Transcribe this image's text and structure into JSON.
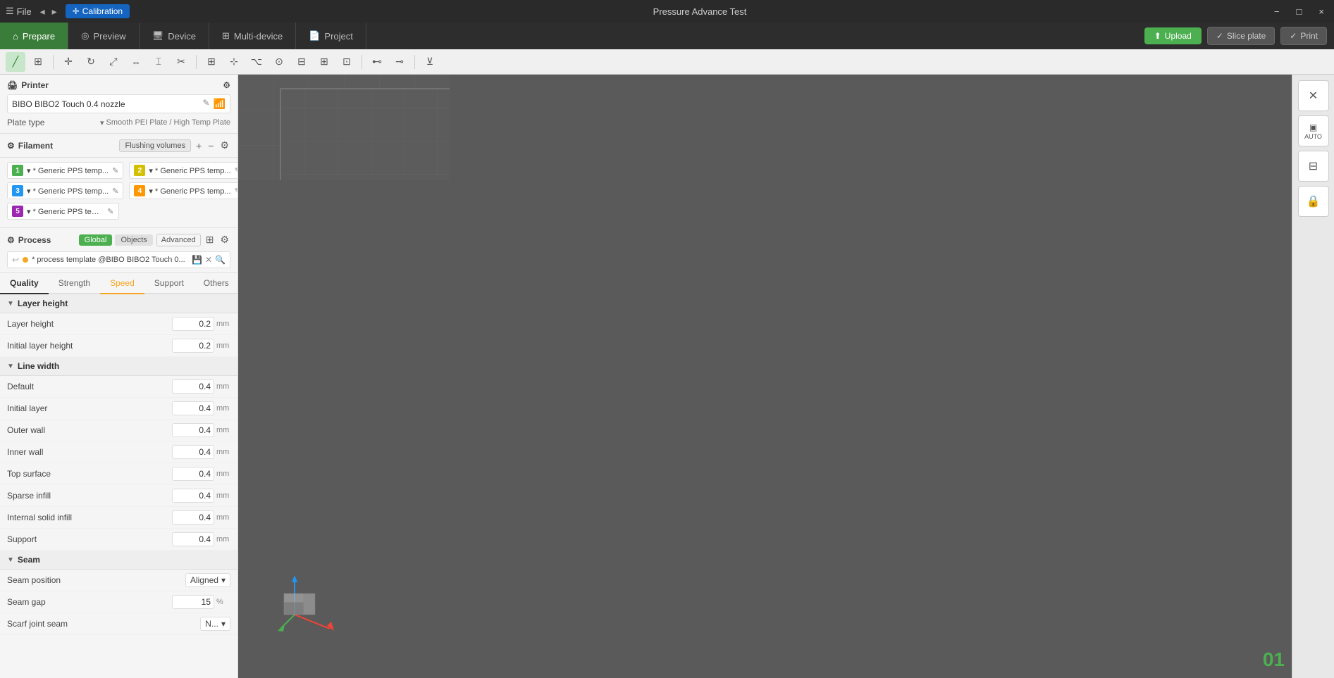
{
  "titleBar": {
    "fileLabel": "File",
    "appTitle": "Pressure Advance Test",
    "calibrationLabel": "Calibration",
    "minBtn": "−",
    "maxBtn": "□",
    "closeBtn": "×"
  },
  "navTabs": [
    {
      "id": "prepare",
      "label": "Prepare",
      "icon": "⌂",
      "active": true
    },
    {
      "id": "preview",
      "label": "Preview",
      "icon": "👁"
    },
    {
      "id": "device",
      "label": "Device",
      "icon": "🖥"
    },
    {
      "id": "multi-device",
      "label": "Multi-device",
      "icon": "⊞"
    },
    {
      "id": "project",
      "label": "Project",
      "icon": "📄"
    }
  ],
  "navButtons": {
    "upload": "Upload",
    "slicePlate": "Slice plate",
    "print": "Print"
  },
  "sidebar": {
    "printer": {
      "sectionTitle": "Printer",
      "printerName": "BIBO BIBO2 Touch 0.4 nozzle",
      "plateTypeLabel": "Plate type",
      "plateTypeValue": "Smooth PEI Plate / High Temp Plate"
    },
    "filament": {
      "sectionTitle": "Filament",
      "flushingVolumes": "Flushing volumes",
      "items": [
        {
          "num": "1",
          "name": "Generic PPS temp...",
          "color": "#4caf50"
        },
        {
          "num": "2",
          "name": "Generic PPS temp...",
          "color": "#ffeb3b"
        },
        {
          "num": "3",
          "name": "Generic PPS temp...",
          "color": "#2196f3"
        },
        {
          "num": "4",
          "name": "Generic PPS temp...",
          "color": "#ff9800"
        },
        {
          "num": "5",
          "name": "Generic PPS temp...",
          "color": "#9c27b0"
        }
      ]
    },
    "process": {
      "sectionTitle": "Process",
      "globalTab": "Global",
      "objectsTab": "Objects",
      "advancedBtn": "Advanced",
      "templateName": "* process template @BIBO BIBO2 Touch 0...",
      "templateDotColor": "#f5a623"
    },
    "qualityTabs": [
      {
        "id": "quality",
        "label": "Quality",
        "active": true
      },
      {
        "id": "strength",
        "label": "Strength"
      },
      {
        "id": "speed",
        "label": "Speed",
        "speedActive": true
      },
      {
        "id": "support",
        "label": "Support"
      },
      {
        "id": "others",
        "label": "Others"
      }
    ],
    "layerHeight": {
      "groupTitle": "Layer height",
      "rows": [
        {
          "label": "Layer height",
          "value": "0.2",
          "unit": "mm"
        },
        {
          "label": "Initial layer height",
          "value": "0.2",
          "unit": "mm"
        }
      ]
    },
    "lineWidth": {
      "groupTitle": "Line width",
      "rows": [
        {
          "label": "Default",
          "value": "0.4",
          "unit": "mm"
        },
        {
          "label": "Initial layer",
          "value": "0.4",
          "unit": "mm"
        },
        {
          "label": "Outer wall",
          "value": "0.4",
          "unit": "mm"
        },
        {
          "label": "Inner wall",
          "value": "0.4",
          "unit": "mm"
        },
        {
          "label": "Top surface",
          "value": "0.4",
          "unit": "mm"
        },
        {
          "label": "Sparse infill",
          "value": "0.4",
          "unit": "mm"
        },
        {
          "label": "Internal solid infill",
          "value": "0.4",
          "unit": "mm"
        },
        {
          "label": "Support",
          "value": "0.4",
          "unit": "mm"
        }
      ]
    },
    "seam": {
      "groupTitle": "Seam",
      "rows": [
        {
          "label": "Seam position",
          "value": "Aligned",
          "type": "dropdown"
        },
        {
          "label": "Seam gap",
          "value": "15",
          "unit": "%"
        },
        {
          "label": "Scarf joint seam",
          "value": "N...",
          "type": "dropdown"
        }
      ]
    }
  },
  "viewport": {
    "pageNumber": "01"
  },
  "rightPanel": {
    "buttons": [
      {
        "icon": "✕",
        "name": "close-view"
      },
      {
        "icon": "⊞",
        "name": "auto-layout"
      },
      {
        "icon": "⊟",
        "name": "table-view"
      },
      {
        "icon": "🔒",
        "name": "lock-view"
      }
    ]
  }
}
